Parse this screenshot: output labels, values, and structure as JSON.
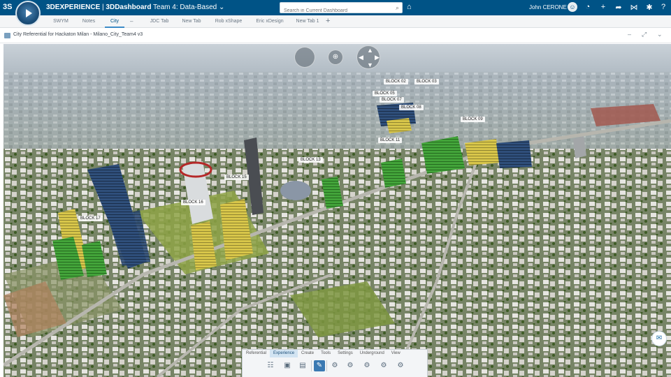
{
  "app": {
    "brand_mark": "3S",
    "platform": "3DEXPERIENCE",
    "separator": " | ",
    "dashboard": "3DDashboard",
    "dashboard_name": "Team 4: Data-Based",
    "dropdown_glyph": "⌄"
  },
  "search": {
    "placeholder": "Search in Current Dashboard",
    "icon": "search-icon"
  },
  "user": {
    "name": "John CERONE"
  },
  "top_icons": [
    "tag-icon",
    "compass-icon",
    "add-icon",
    "share-icon",
    "network-icon",
    "tools-icon"
  ],
  "tabs": [
    {
      "label": "SWYM"
    },
    {
      "label": "Notes"
    },
    {
      "label": "City",
      "active": true
    },
    {
      "label": "JDC Tab"
    },
    {
      "label": "New Tab"
    },
    {
      "label": "Rob xShape"
    },
    {
      "label": "Eric xDesign"
    },
    {
      "label": "New Tab 1"
    }
  ],
  "tab_dash": "–",
  "tab_plus": "+",
  "widget": {
    "title": "City Referential for Hackaton Milan - Milano_City_Team4 v3",
    "minimize": "–",
    "maximize": "⤢",
    "menu": "⌄"
  },
  "viewport": {
    "nav": {
      "zoom": "⊕"
    },
    "blocks": [
      {
        "label": "BLOCK 02"
      },
      {
        "label": "BLOCK 03"
      },
      {
        "label": "BLOCK 05"
      },
      {
        "label": "BLOCK 07"
      },
      {
        "label": "BLOCK 08"
      },
      {
        "label": "BLOCK 09"
      },
      {
        "label": "BLOCK 11"
      },
      {
        "label": "BLOCK 13"
      },
      {
        "label": "BLOCK 15"
      },
      {
        "label": "BLOCK 16"
      },
      {
        "label": "BLOCK 17"
      }
    ]
  },
  "action_bar": {
    "tabs": [
      "Referential",
      "Experience",
      "Create",
      "Tools",
      "Settings",
      "Underground",
      "View"
    ],
    "active_tab": "Experience",
    "tools": [
      {
        "icon": "tree-icon",
        "glyph": "☷"
      },
      {
        "icon": "image-icon",
        "glyph": "▣"
      },
      {
        "icon": "table-icon",
        "glyph": "▤"
      },
      {
        "icon": "pencil-icon",
        "glyph": "✎",
        "active": true
      },
      {
        "icon": "gear-group-icon",
        "glyph": "⚙"
      },
      {
        "icon": "gear-play-icon",
        "glyph": "⚙"
      },
      {
        "icon": "gear-settings-icon",
        "glyph": "⚙"
      },
      {
        "icon": "gear-person-icon",
        "glyph": "⚙"
      },
      {
        "icon": "gear-check-icon",
        "glyph": "⚙"
      }
    ]
  },
  "colors": {
    "topbar": "#005386",
    "accent": "#3d8bc7",
    "active_tool": "#3a79b2"
  }
}
